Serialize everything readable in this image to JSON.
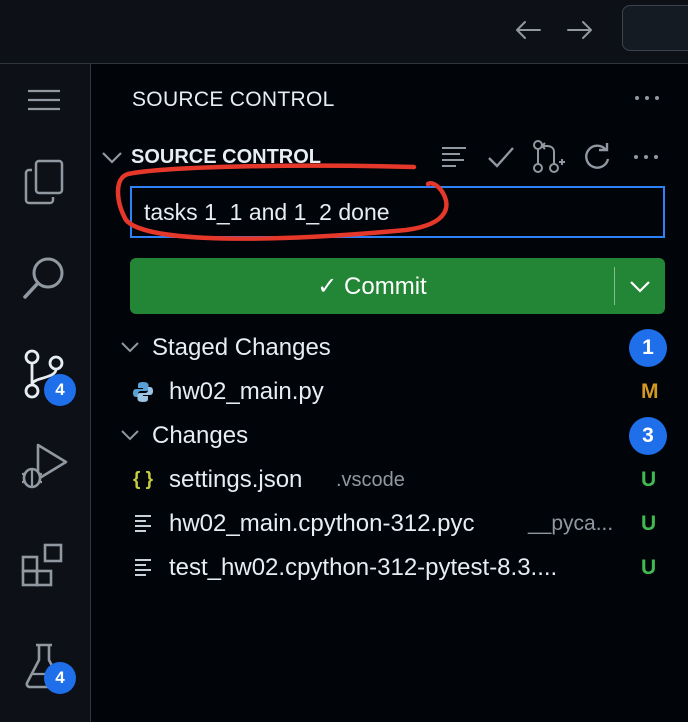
{
  "titlebar": {
    "back_icon": "arrow-left-icon",
    "forward_icon": "arrow-right-icon"
  },
  "activity_bar": {
    "items": [
      {
        "name": "menu",
        "icon": "hamburger-icon"
      },
      {
        "name": "explorer",
        "icon": "files-icon"
      },
      {
        "name": "search",
        "icon": "search-icon"
      },
      {
        "name": "source-control",
        "icon": "source-control-icon",
        "badge": "4",
        "active": true
      },
      {
        "name": "run-debug",
        "icon": "debug-icon"
      },
      {
        "name": "extensions",
        "icon": "extensions-icon"
      },
      {
        "name": "testing",
        "icon": "beaker-icon",
        "badge": "4"
      }
    ]
  },
  "sidebar": {
    "view_title": "SOURCE CONTROL",
    "section_title": "SOURCE CONTROL",
    "commit_message": "tasks 1_1 and 1_2 done",
    "commit_label": "✓ Commit",
    "header_actions": [
      "view-as-list-icon",
      "check-icon",
      "pull-request-icon",
      "refresh-icon",
      "more-icon"
    ],
    "groups": [
      {
        "label": "Staged Changes",
        "count": "1",
        "files": [
          {
            "name": "hw02_main.py",
            "dir": "",
            "status": "M",
            "icon": "python-icon"
          }
        ]
      },
      {
        "label": "Changes",
        "count": "3",
        "files": [
          {
            "name": "settings.json",
            "dir": ".vscode",
            "status": "U",
            "icon": "json-icon"
          },
          {
            "name": "hw02_main.cpython-312.pyc",
            "dir": "__pyca...",
            "status": "U",
            "icon": "file-lines-icon"
          },
          {
            "name": "test_hw02.cpython-312-pytest-8.3....",
            "dir": "",
            "status": "U",
            "icon": "file-lines-icon"
          }
        ]
      }
    ]
  },
  "colors": {
    "accent": "#1f6feb",
    "commit_green": "#238636",
    "modified": "#d29922",
    "untracked": "#3fb950",
    "annotation_red": "#e5382b"
  }
}
